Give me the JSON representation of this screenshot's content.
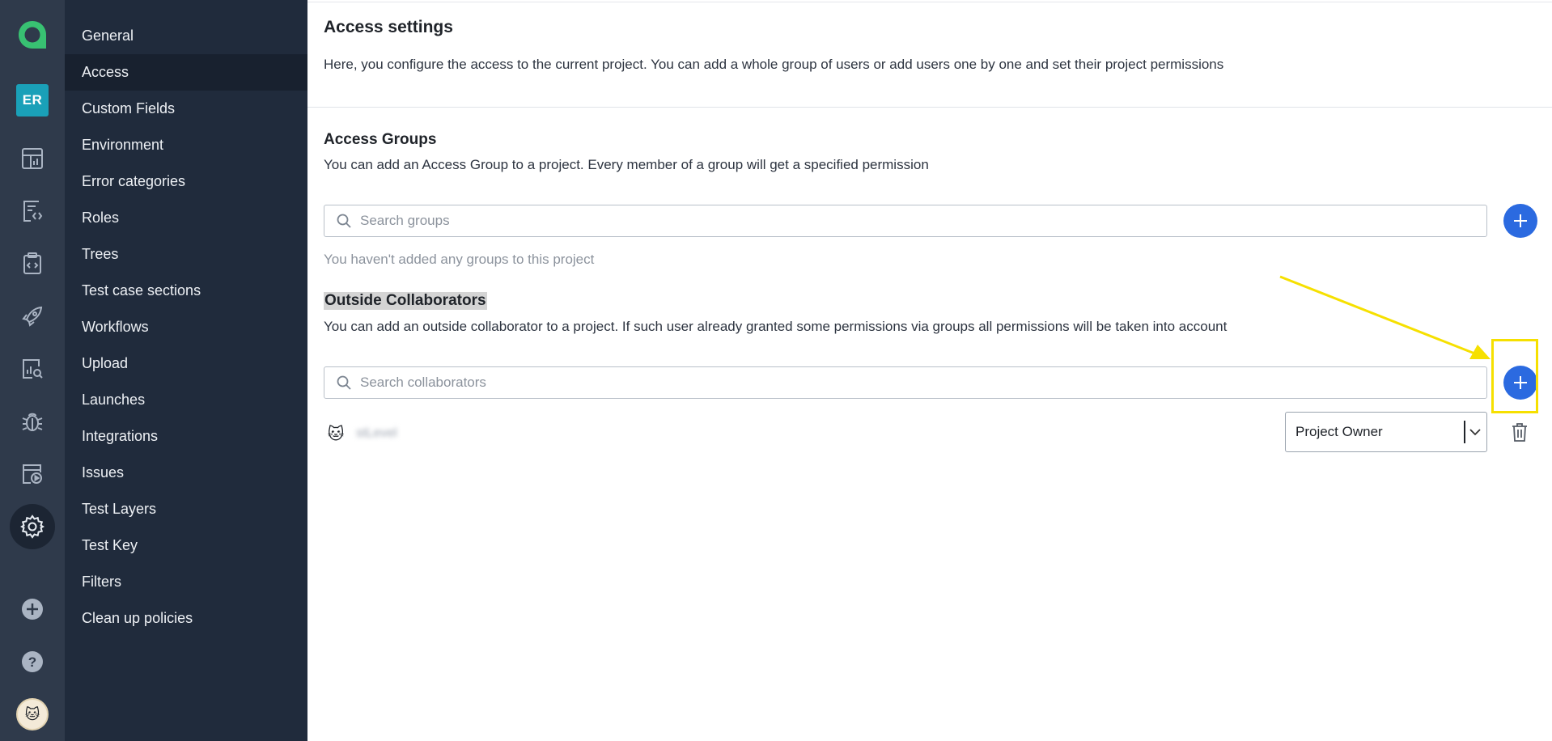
{
  "rail": {
    "user_initials": "ER",
    "icons": [
      "app-logo",
      "dashboard-icon",
      "test-cases-icon",
      "test-plans-icon",
      "launches-icon",
      "analytics-icon",
      "bug-icon",
      "jobs-icon",
      "settings-icon",
      "add-icon",
      "help-icon",
      "user-avatar"
    ]
  },
  "menu": {
    "items": [
      "General",
      "Access",
      "Custom Fields",
      "Environment",
      "Error categories",
      "Roles",
      "Trees",
      "Test case sections",
      "Workflows",
      "Upload",
      "Launches",
      "Integrations",
      "Issues",
      "Test Layers",
      "Test Key",
      "Filters",
      "Clean up policies"
    ],
    "active": "Access"
  },
  "page": {
    "title": "Access settings",
    "description": "Here, you configure the access to the current project. You can add a whole group of users or add users one by one and set their project permissions"
  },
  "groups": {
    "title": "Access Groups",
    "description": "You can add an Access Group to a project. Every member of a group will get a specified permission",
    "search_placeholder": "Search groups",
    "empty_text": "You haven't added any groups to this project"
  },
  "collaborators": {
    "title": "Outside Collaborators",
    "description": "You can add an outside collaborator to a project. If such user already granted some permissions via groups all permissions will be taken into account",
    "search_placeholder": "Search collaborators",
    "rows": [
      {
        "name": "stLevel",
        "role": "Project Owner"
      }
    ]
  },
  "colors": {
    "rail_bg": "#2f3a4b",
    "menu_bg": "#202b3c",
    "accent": "#2b6ae0",
    "logo": "#38c172",
    "annotation": "#f6e000"
  }
}
